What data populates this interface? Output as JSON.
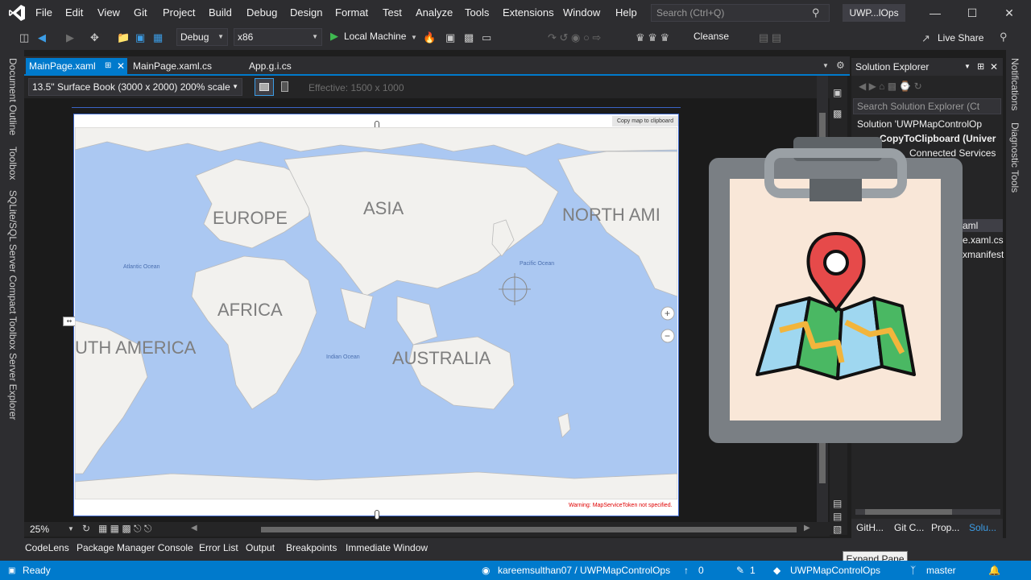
{
  "menu": [
    "File",
    "Edit",
    "View",
    "Git",
    "Project",
    "Build",
    "Debug",
    "Design",
    "Format",
    "Test",
    "Analyze",
    "Tools",
    "Extensions",
    "Window",
    "Help"
  ],
  "search": {
    "placeholder": "Search (Ctrl+Q)"
  },
  "window_title": "UWP...lOps",
  "toolbar": {
    "config": "Debug",
    "platform": "x86",
    "run_target": "Local Machine",
    "cleanse": "Cleanse",
    "live_share": "Live Share"
  },
  "left_strip": [
    "Document Outline",
    "Toolbox",
    "SQLite/SQL Server Compact Toolbox",
    "Server Explorer"
  ],
  "tabs": [
    {
      "label": "MainPage.xaml",
      "active": true
    },
    {
      "label": "MainPage.xaml.cs",
      "active": false
    },
    {
      "label": "App.g.i.cs",
      "active": false
    }
  ],
  "designer": {
    "device": "13.5\" Surface Book (3000 x 2000) 200% scale",
    "effective": "Effective: 1500 x 1000",
    "zoom": "25%"
  },
  "map": {
    "copy_button": "Copy map to clipboard",
    "warning": "Warning: MapServiceToken not specified.",
    "continents": [
      "EUROPE",
      "ASIA",
      "NORTH AMI",
      "AFRICA",
      "UTH AMERICA",
      "AUSTRALIA"
    ],
    "oceans": [
      "Atlantic Ocean",
      "Pacific Ocean",
      "Indian Ocean"
    ]
  },
  "solution_explorer": {
    "title": "Solution Explorer",
    "search_placeholder": "Search Solution Explorer (Ct",
    "items": [
      "Solution 'UWPMapControlOp",
      "CopyToClipboard (Univer",
      "Connected Services",
      "aml",
      "e.xaml.cs",
      "xmanifest"
    ],
    "tabs": [
      "GitH...",
      "Git C...",
      "Prop...",
      "Solu..."
    ]
  },
  "right_strip": [
    "Notifications",
    "Diagnostic Tools"
  ],
  "tool_tabs": [
    "CodeLens",
    "Package Manager Console",
    "Error List",
    "Output",
    "Breakpoints",
    "Immediate Window"
  ],
  "expand_pane": "Expand Pane",
  "status": {
    "ready": "Ready",
    "repo": "kareemsulthan07 / UWPMapControlOps",
    "up": "0",
    "changes": "1",
    "project": "UWPMapControlOps",
    "branch": "master"
  }
}
